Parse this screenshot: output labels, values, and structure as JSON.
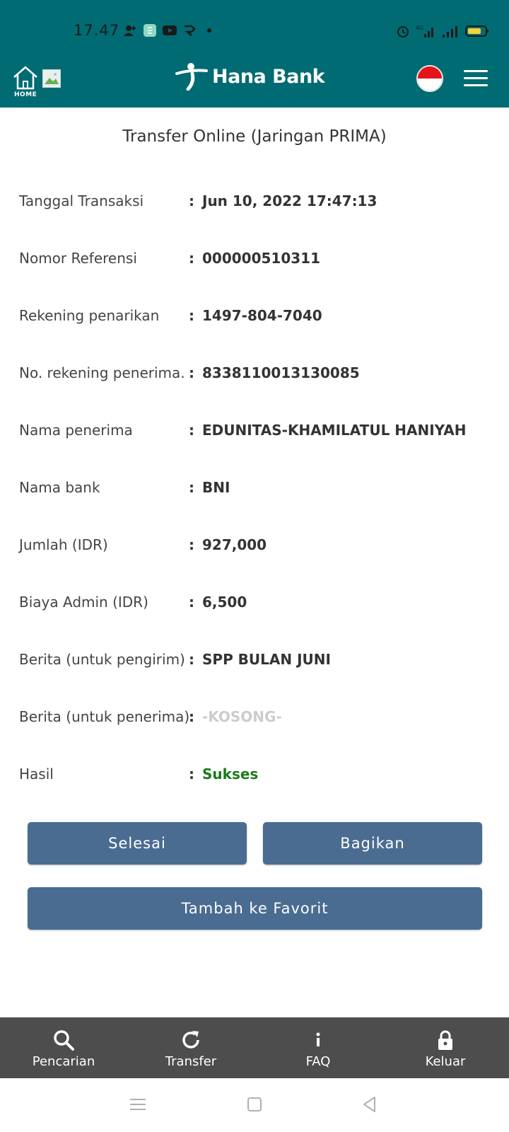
{
  "status_bar": {
    "time": "17.47",
    "battery_color": "#f2d23a"
  },
  "header": {
    "home_label": "HOME",
    "brand": "Hana Bank",
    "language": "Indonesia flag",
    "bg_color": "#006b73"
  },
  "page": {
    "title": "Transfer Online (Jaringan PRIMA)"
  },
  "details": [
    {
      "label": "Tanggal Transaksi",
      "value": "Jun 10, 2022 17:47:13"
    },
    {
      "label": "Nomor Referensi",
      "value": "000000510311"
    },
    {
      "label": "Rekening penarikan",
      "value": "1497-804-7040"
    },
    {
      "label": "No. rekening penerima.",
      "value": "8338110013130085"
    },
    {
      "label": "Nama penerima",
      "value": "EDUNITAS-KHAMILATUL HANIYAH"
    },
    {
      "label": "Nama bank",
      "value": "BNI"
    },
    {
      "label": "Jumlah (IDR)",
      "value": "927,000"
    },
    {
      "label": "Biaya Admin (IDR)",
      "value": "6,500"
    },
    {
      "label": "Berita (untuk pengirim)",
      "value": "SPP BULAN JUNI"
    },
    {
      "label": "Berita (untuk penerima)",
      "value": "-KOSONG-"
    },
    {
      "label": "Hasil",
      "value": "Sukses"
    }
  ],
  "colon": ":",
  "buttons": {
    "done": "Selesai",
    "share": "Bagikan",
    "favorite": "Tambah ke Favorit",
    "color": "#4a6c91"
  },
  "bottom_nav": [
    {
      "label": "Pencarian",
      "icon": "search-icon"
    },
    {
      "label": "Transfer",
      "icon": "refresh-icon"
    },
    {
      "label": "FAQ",
      "icon": "info-icon"
    },
    {
      "label": "Keluar",
      "icon": "lock-icon"
    }
  ]
}
